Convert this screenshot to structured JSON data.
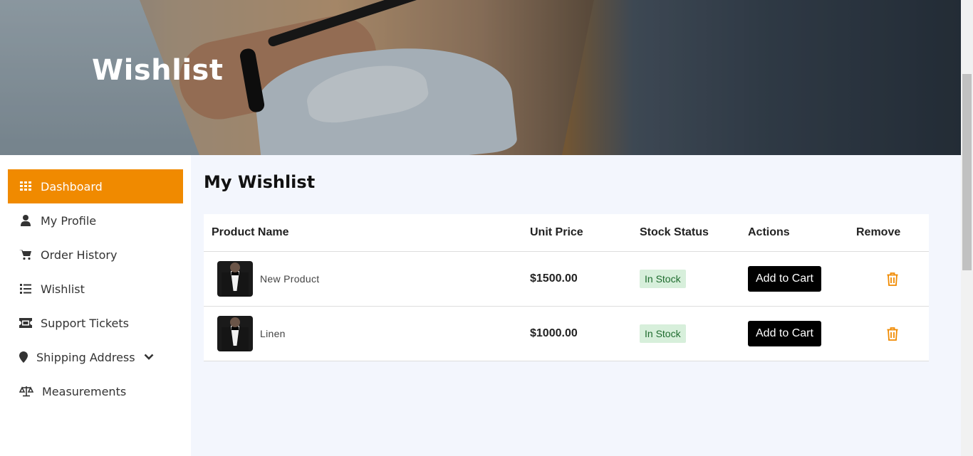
{
  "hero": {
    "title": "Wishlist"
  },
  "sidebar": {
    "items": [
      {
        "label": "Dashboard",
        "icon": "grid-icon",
        "active": true
      },
      {
        "label": "My Profile",
        "icon": "user-icon"
      },
      {
        "label": "Order History",
        "icon": "cart-icon"
      },
      {
        "label": "Wishlist",
        "icon": "list-icon"
      },
      {
        "label": "Support Tickets",
        "icon": "ticket-icon"
      },
      {
        "label": "Shipping Address",
        "icon": "map-pin-icon",
        "has_dropdown": true
      },
      {
        "label": "Measurements",
        "icon": "scale-icon"
      }
    ]
  },
  "main": {
    "title": "My Wishlist",
    "table": {
      "headers": [
        "Product Name",
        "Unit Price",
        "Stock Status",
        "Actions",
        "Remove"
      ],
      "rows": [
        {
          "name": "New Product",
          "price": "$1500.00",
          "stock": "In Stock",
          "action": "Add to Cart"
        },
        {
          "name": "Linen",
          "price": "$1000.00",
          "stock": "In Stock",
          "action": "Add to Cart"
        }
      ]
    }
  },
  "colors": {
    "accent": "#f08a00",
    "badge_bg": "#d7efdb",
    "badge_text": "#1e6b2e",
    "page_bg": "#f3f6fd"
  }
}
